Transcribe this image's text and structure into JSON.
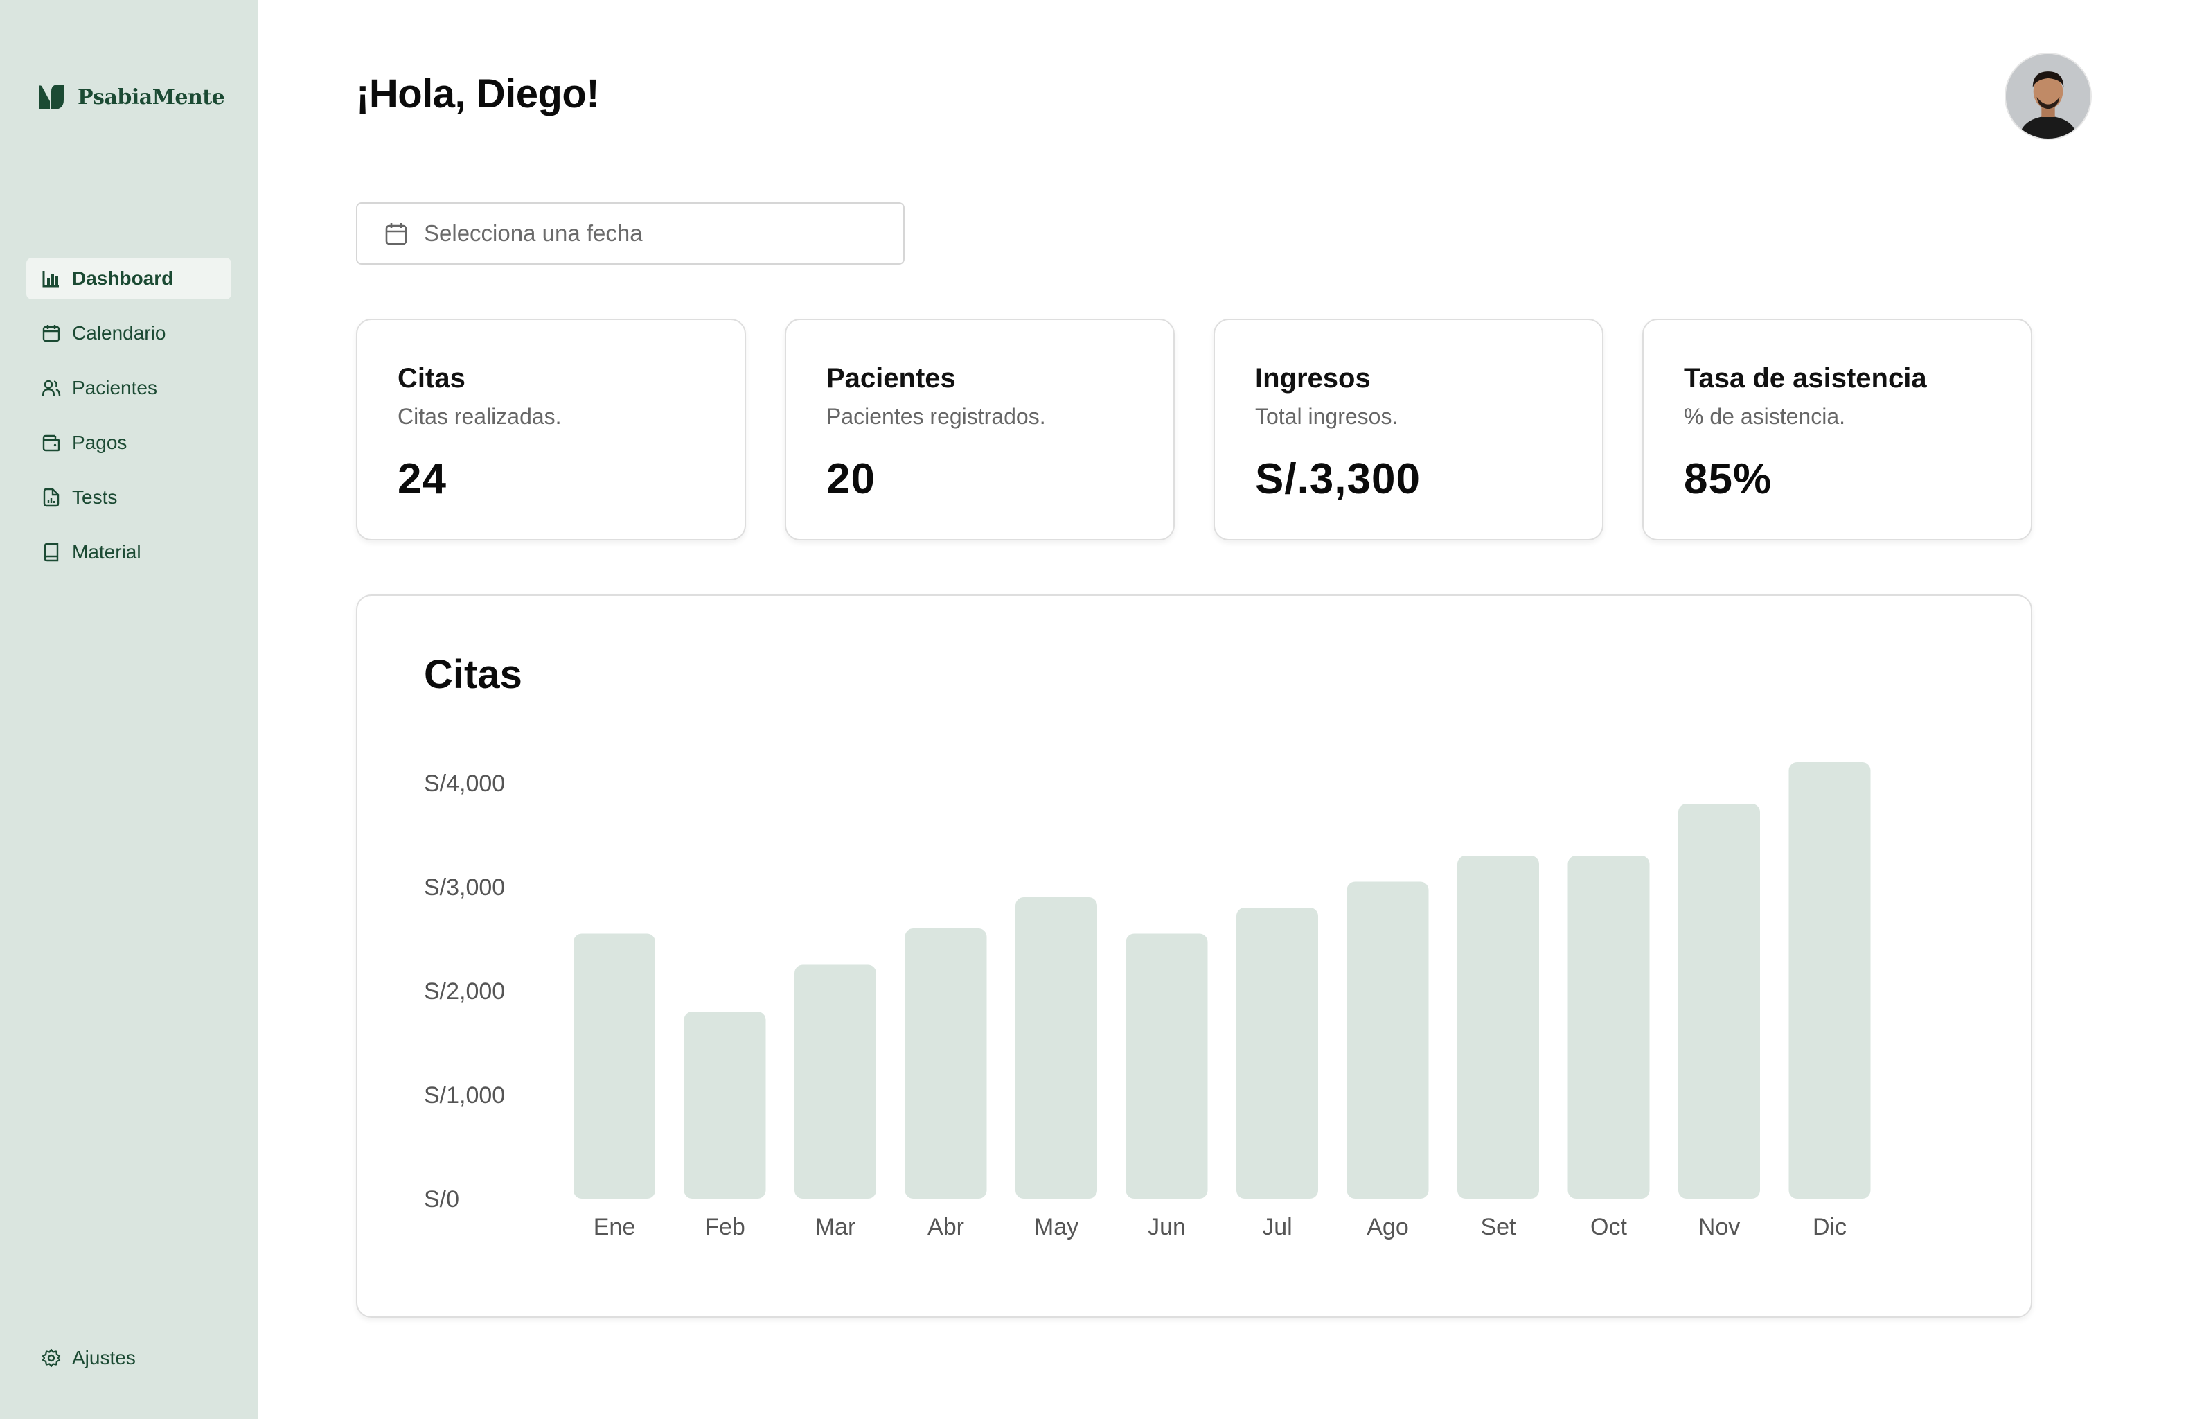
{
  "brand": {
    "name": "PsabiaMente"
  },
  "sidebar": {
    "items": [
      {
        "label": "Dashboard",
        "icon": "bar-chart-icon",
        "active": true
      },
      {
        "label": "Calendario",
        "icon": "calendar-icon"
      },
      {
        "label": "Pacientes",
        "icon": "users-icon"
      },
      {
        "label": "Pagos",
        "icon": "wallet-icon"
      },
      {
        "label": "Tests",
        "icon": "file-chart-icon"
      },
      {
        "label": "Material",
        "icon": "book-icon"
      }
    ],
    "settings": {
      "label": "Ajustes",
      "icon": "gear-icon"
    }
  },
  "header": {
    "greeting": "¡Hola, Diego!"
  },
  "date_picker": {
    "placeholder": "Selecciona una fecha",
    "icon": "calendar-icon"
  },
  "stats": [
    {
      "title": "Citas",
      "subtitle": "Citas realizadas.",
      "value": "24"
    },
    {
      "title": "Pacientes",
      "subtitle": "Pacientes registrados.",
      "value": "20"
    },
    {
      "title": "Ingresos",
      "subtitle": "Total ingresos.",
      "value": "S/.3,300"
    },
    {
      "title": "Tasa de asistencia",
      "subtitle": "% de asistencia.",
      "value": "85%"
    }
  ],
  "colors": {
    "sidebar_bg": "#dae5df",
    "brand_green": "#1b4a33",
    "bar": "#dae5df"
  },
  "chart_data": {
    "type": "bar",
    "title": "Citas",
    "categories": [
      "Ene",
      "Feb",
      "Mar",
      "Abr",
      "May",
      "Jun",
      "Jul",
      "Ago",
      "Set",
      "Oct",
      "Nov",
      "Dic"
    ],
    "values": [
      2550,
      1800,
      2250,
      2600,
      2900,
      2550,
      2800,
      3050,
      3300,
      3300,
      3800,
      4200
    ],
    "y_ticks": [
      "S/4,000",
      "S/3,000",
      "S/2,000",
      "S/1,000",
      "S/0"
    ],
    "ylim": [
      0,
      4000
    ],
    "grid": false,
    "xlabel": "",
    "ylabel": ""
  }
}
